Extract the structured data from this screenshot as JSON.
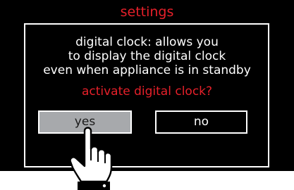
{
  "dialog": {
    "title": "settings",
    "message_lines": [
      "digital clock: allows you",
      "to display the digital clock",
      "even when appliance is in standby"
    ],
    "question": "activate digital clock?",
    "yes_label": "yes",
    "no_label": "no"
  },
  "colors": {
    "background": "#000000",
    "accent": "#e6202a",
    "text": "#ffffff",
    "selected_button": "#a7a9ac"
  },
  "icons": {
    "pointer": "pointing-hand-icon"
  }
}
